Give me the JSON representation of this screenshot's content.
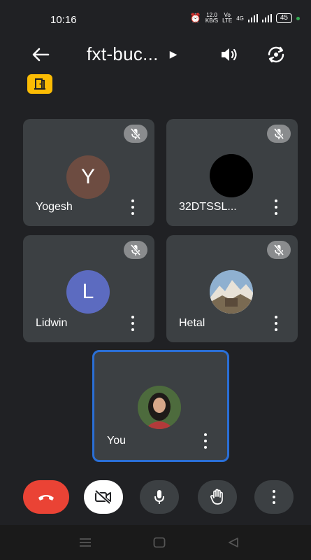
{
  "status": {
    "time": "10:16",
    "speed_value": "12.0",
    "speed_unit": "KB/S",
    "volte_top": "Vo",
    "volte_bottom": "LTE",
    "network": "4G",
    "battery": "45"
  },
  "header": {
    "title": "fxt-buc..."
  },
  "participants": [
    {
      "name": "Yogesh",
      "initial": "Y",
      "avatar_color": "#6d4c41",
      "muted": true
    },
    {
      "name": "32DTSSL...",
      "initial": "",
      "avatar_color": "#000000",
      "muted": true
    },
    {
      "name": "Lidwin",
      "initial": "L",
      "avatar_color": "#5c6bc0",
      "muted": true
    },
    {
      "name": "Hetal",
      "initial": "",
      "avatar_color": "#7fa3c8",
      "muted": true
    }
  ],
  "self": {
    "name": "You"
  },
  "colors": {
    "background": "#202124",
    "tile": "#3c4043",
    "end_call": "#ea4335",
    "self_border": "#2a6fd6",
    "room_badge": "#fbbc04"
  },
  "icons": {
    "back": "arrow-left-icon",
    "title_caret": "caret-right-icon",
    "speaker": "volume-icon",
    "switch_camera": "switch-camera-icon",
    "room": "door-icon",
    "muted": "mic-off-icon",
    "more": "more-vertical-icon",
    "end_call": "phone-hangup-icon",
    "camera_off": "video-off-icon",
    "mic": "mic-icon",
    "hand": "raise-hand-icon"
  }
}
